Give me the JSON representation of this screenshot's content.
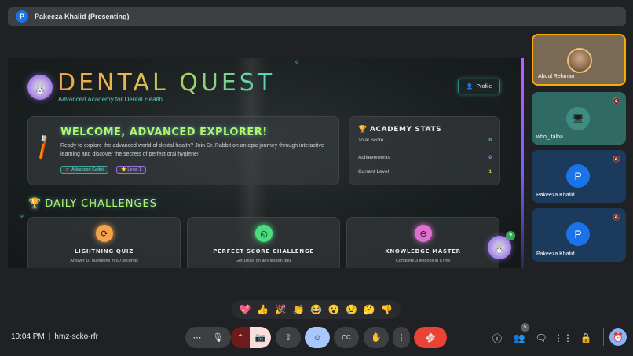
{
  "meeting": {
    "presenter_initial": "P",
    "presenter_label": "Pakeeza Khalid (Presenting)",
    "time": "10:04 PM",
    "separator": "|",
    "code": "hmz-scko-rfr",
    "participant_count": "5"
  },
  "app": {
    "logo_glyph": "🐰",
    "title": "DENTAL QUEST",
    "subtitle": "Advanced Academy for Dental Health",
    "profile_label": "Profile",
    "welcome": {
      "heading": "WELCOME, ADVANCED EXPLORER!",
      "text": "Ready to explore the advanced world of dental health? Join Dr. Rabbit on an epic journey through interactive learning and discover the secrets of perfect oral hygiene!",
      "tags": [
        "🎓 Advanced Cadet",
        "⭐ Level 1"
      ]
    },
    "stats": {
      "heading": "ACADEMY STATS",
      "rows": [
        {
          "label": "Total Score",
          "value": "0",
          "color": "#4fd1c5"
        },
        {
          "label": "Achievements",
          "value": "0",
          "color": "#b48cff"
        },
        {
          "label": "Current Level",
          "value": "1",
          "color": "#e6c84e"
        }
      ]
    },
    "challenges_heading": "DAILY CHALLENGES",
    "challenges": [
      {
        "icon": "⟳",
        "title": "LIGHTNING QUIZ",
        "desc": "Answer 10 questions in 60 seconds",
        "color": "#f4a34a"
      },
      {
        "icon": "◎",
        "title": "PERFECT SCORE CHALLENGE",
        "desc": "Get 100% on any lesson quiz",
        "color": "#4ade80"
      },
      {
        "icon": "⊖",
        "title": "KNOWLEDGE MASTER",
        "desc": "Complete 3 lessons in a row",
        "color": "#e06fd0"
      }
    ],
    "helper_badge": "?"
  },
  "participants": [
    {
      "name": "Abdul Rehman",
      "muted": false
    },
    {
      "name": "who_ talha",
      "muted": true
    },
    {
      "name": "Pakeeza Khalid",
      "initial": "P",
      "muted": true
    },
    {
      "name": "Pakeeza Khalid",
      "initial": "P",
      "muted": true
    }
  ],
  "reactions": [
    "💖",
    "👍",
    "🎉",
    "👏",
    "😂",
    "😮",
    "😢",
    "🤔",
    "👎"
  ],
  "controls": {
    "more": "⋯",
    "mic": "🎙",
    "chevron": "⌃",
    "camera_off": "📷",
    "present": "⇧",
    "emoji": "☺",
    "captions": "CC",
    "raise_hand": "✋",
    "options": "⋮",
    "end_call": "☎"
  },
  "colors": {
    "accent_teal": "#4fd1c5",
    "accent_green": "#b5f36e",
    "end_call": "#ea4335",
    "active_speaker": "#f9ab00"
  }
}
